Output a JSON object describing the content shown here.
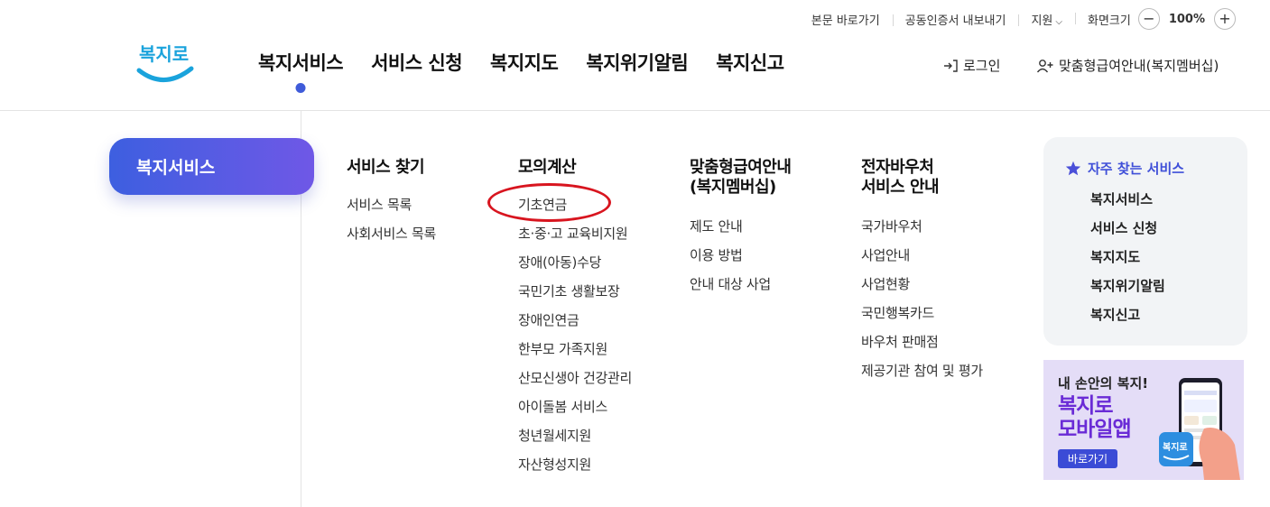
{
  "utility": {
    "skip_link": "본문 바로가기",
    "cert_export": "공동인증서 내보내기",
    "region": "지원",
    "zoom_label": "화면크기",
    "zoom_value": "100%",
    "zoom_minus": "−",
    "zoom_plus": "+"
  },
  "logo": {
    "text": "복지로"
  },
  "gnb": [
    "복지서비스",
    "서비스 신청",
    "복지지도",
    "복지위기알림",
    "복지신고"
  ],
  "account": {
    "login": "로그인",
    "member": "맞춤형급여안내(복지멤버십)"
  },
  "side": {
    "title": "복지서비스"
  },
  "columns": {
    "c1": {
      "title": "서비스 찾기",
      "items": [
        "서비스 목록",
        "사회서비스 목록"
      ]
    },
    "c2": {
      "title": "모의계산",
      "items": [
        "기초연금",
        "초·중·고 교육비지원",
        "장애(아동)수당",
        "국민기초 생활보장",
        "장애인연금",
        "한부모 가족지원",
        "산모신생아 건강관리",
        "아이돌봄 서비스",
        "청년월세지원",
        "자산형성지원"
      ]
    },
    "c3": {
      "title_line1": "맞춤형급여안내",
      "title_line2": "(복지멤버십)",
      "items": [
        "제도 안내",
        "이용 방법",
        "안내 대상 사업"
      ]
    },
    "c4": {
      "title_line1": "전자바우처",
      "title_line2": "서비스 안내",
      "items": [
        "국가바우처",
        "사업안내",
        "사업현황",
        "국민행복카드",
        "바우처 판매점",
        "제공기관 참여 및 평가"
      ]
    }
  },
  "favorites": {
    "heading": "자주 찾는 서비스",
    "items": [
      "복지서비스",
      "서비스 신청",
      "복지지도",
      "복지위기알림",
      "복지신고"
    ]
  },
  "banner": {
    "line1": "내 손안의 복지!",
    "line2": "복지로",
    "line3": "모바일앱",
    "button": "바로가기",
    "app_icon_text": "복지로"
  },
  "colors": {
    "accent": "#3f5bd9",
    "pill_start": "#3d5fe0",
    "pill_end": "#6f58e6",
    "highlight_circle": "#d8151f",
    "banner_text": "#6a2bd6"
  },
  "icons": [
    "chevron-down-icon",
    "login-icon",
    "add-user-icon",
    "star-icon",
    "phone-icon",
    "hand-icon"
  ]
}
